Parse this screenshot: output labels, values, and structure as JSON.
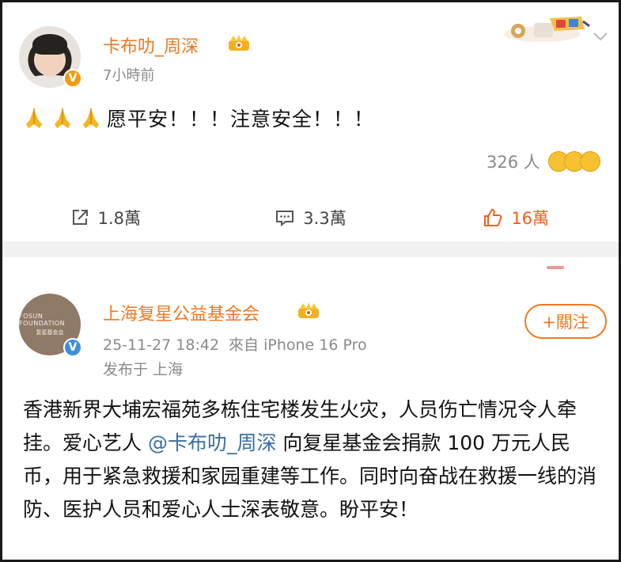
{
  "post1": {
    "author": "卡布叻_周深",
    "time": "7小時前",
    "text": "愿平安！！！注意安全！！！",
    "reactions": "326 人",
    "actions": {
      "repost": "1.8萬",
      "comment": "3.3萬",
      "like": "16萬"
    }
  },
  "post2": {
    "author": "上海复星公益基金会",
    "avatar_text_en": "FOSUN FOUNDATION",
    "avatar_text_cn": "复星基金会",
    "follow_label": "+關注",
    "datetime": "25-11-27 18:42",
    "source": "來自 iPhone 16 Pro",
    "location": "发布于 上海",
    "text_before": "香港新界大埔宏福苑多栋住宅楼发生火灾，人员伤亡情况令人牵挂。爱心艺人 ",
    "mention": "@卡布叻_周深",
    "text_after": " 向复星基金会捐款 100 万元人民币，用于紧急救援和家园重建等工作。同时向奋战在救援一线的消防、医护人员和爱心人士深表敬意。盼平安！"
  },
  "colors": {
    "name": "#f07820",
    "like": "#f0601e",
    "meta": "#8a8a8a",
    "mention": "#3a6ea5",
    "verified_orange": "#f29a12",
    "verified_blue": "#3f8fd8"
  }
}
